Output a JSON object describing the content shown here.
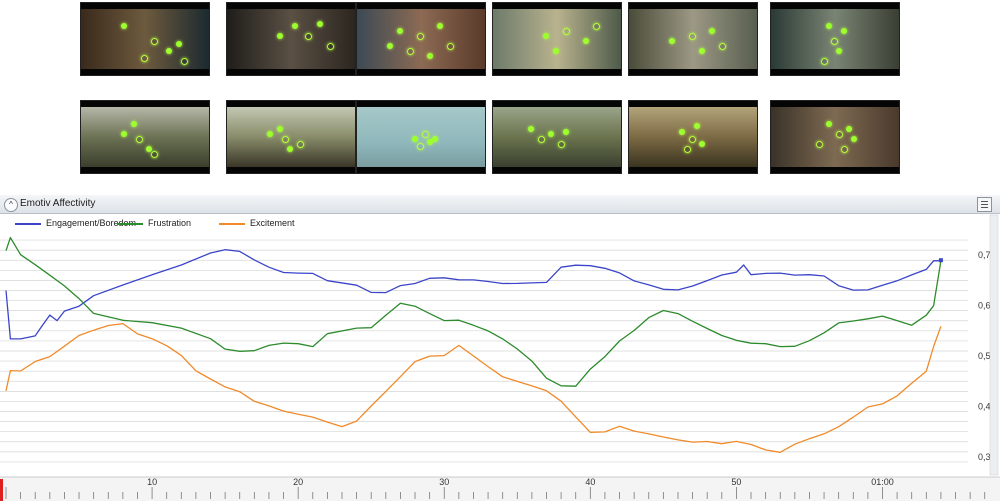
{
  "thumbnails": [
    {
      "name": "clip-1",
      "bg": "linear-gradient(90deg,#3a2a1c,#6d5a3e 50%,#1c2a30)",
      "row": 0,
      "col": 0
    },
    {
      "name": "clip-2",
      "bg": "linear-gradient(90deg,#1f1d1a,#5a5044 50%,#2c2620)",
      "row": 0,
      "col": 1
    },
    {
      "name": "clip-3",
      "bg": "linear-gradient(90deg,#3c4a55,#8c6a54 50%,#5a3a2a)",
      "row": 0,
      "col": 2
    },
    {
      "name": "clip-4",
      "bg": "linear-gradient(90deg,#6d7a6a,#b9b38e 50%,#4e5a4a)",
      "row": 0,
      "col": 3
    },
    {
      "name": "clip-5",
      "bg": "linear-gradient(90deg,#4a4c3a,#9c9884 50%,#585e50)",
      "row": 0,
      "col": 4
    },
    {
      "name": "clip-6",
      "bg": "linear-gradient(90deg,#2a3a34,#7a8474 50%,#3a3e34)",
      "row": 0,
      "col": 5
    },
    {
      "name": "clip-7",
      "bg": "linear-gradient(180deg,#b5b7a8,#6c7254 50%,#3a3e2c)",
      "row": 1,
      "col": 0
    },
    {
      "name": "clip-8",
      "bg": "linear-gradient(180deg,#c2c8b2,#888c6a 50%,#3a3628)",
      "row": 1,
      "col": 1
    },
    {
      "name": "clip-9",
      "bg": "linear-gradient(180deg,#a6c8c8,#8fb8bc 60%,#7a9ca0)",
      "row": 1,
      "col": 2
    },
    {
      "name": "clip-10",
      "bg": "linear-gradient(180deg,#9aa48a,#6a744e 50%,#3a4030)",
      "row": 1,
      "col": 3
    },
    {
      "name": "clip-11",
      "bg": "linear-gradient(180deg,#b3a47a,#7c6a44 50%,#3a3420)",
      "row": 1,
      "col": 4
    },
    {
      "name": "clip-12",
      "bg": "linear-gradient(90deg,#3a3228,#7e6a52 50%,#4a3a2c)",
      "row": 1,
      "col": 5
    }
  ],
  "panel": {
    "title": "Emotiv Affectivity",
    "collapse_glyph": "^"
  },
  "chart_data": {
    "type": "line",
    "xlabel": "",
    "ylabel": "",
    "xlim": [
      0,
      64
    ],
    "ylim": [
      0.28,
      0.74
    ],
    "x_ticks": [
      10,
      20,
      30,
      40,
      50,
      60
    ],
    "x_tick_labels": [
      "10",
      "20",
      "30",
      "40",
      "50",
      "01:00"
    ],
    "y_ticks": [
      0.3,
      0.4,
      0.5,
      0.6,
      0.7
    ],
    "y_tick_labels": [
      "0,3",
      "0,4",
      "0,5",
      "0,6",
      "0,7"
    ],
    "grid": true,
    "legend": "top-left",
    "series": [
      {
        "name": "Engagement/Boredom",
        "color": "#3b45c8",
        "x": [
          0,
          0.3,
          1,
          2,
          2.5,
          3,
          3.5,
          4,
          5,
          6,
          8,
          10,
          12,
          14,
          15,
          16,
          17,
          18,
          19,
          20,
          21,
          22,
          24,
          25,
          26,
          27,
          28,
          29,
          30,
          31,
          32,
          33,
          34,
          35,
          36,
          37,
          38,
          39,
          40,
          41,
          42,
          43,
          44,
          45,
          46,
          47,
          48,
          49,
          50,
          50.5,
          51,
          52,
          53,
          54,
          55,
          56,
          57,
          58,
          59,
          60,
          61,
          62,
          63,
          63.5,
          64
        ],
        "y": [
          0.63,
          0.535,
          0.535,
          0.54,
          0.56,
          0.58,
          0.57,
          0.59,
          0.6,
          0.62,
          0.64,
          0.66,
          0.68,
          0.705,
          0.712,
          0.708,
          0.69,
          0.675,
          0.665,
          0.665,
          0.665,
          0.65,
          0.64,
          0.625,
          0.625,
          0.64,
          0.645,
          0.655,
          0.655,
          0.65,
          0.65,
          0.648,
          0.645,
          0.645,
          0.645,
          0.645,
          0.675,
          0.68,
          0.68,
          0.675,
          0.665,
          0.648,
          0.64,
          0.632,
          0.632,
          0.64,
          0.65,
          0.66,
          0.665,
          0.68,
          0.662,
          0.665,
          0.665,
          0.66,
          0.66,
          0.658,
          0.64,
          0.632,
          0.632,
          0.64,
          0.648,
          0.66,
          0.672,
          0.69,
          0.69
        ]
      },
      {
        "name": "Frustration",
        "color": "#2d8b2d",
        "x": [
          0,
          0.3,
          1,
          2,
          3,
          4,
          5,
          6,
          8,
          10,
          12,
          14,
          15,
          16,
          17,
          18,
          19,
          20,
          21,
          22,
          24,
          25,
          26,
          27,
          28,
          29,
          30,
          31,
          32,
          33,
          34,
          35,
          36,
          37,
          38,
          39,
          40,
          41,
          42,
          43,
          44,
          45,
          46,
          47,
          48,
          49,
          50,
          51,
          52,
          53,
          54,
          55,
          56,
          57,
          58,
          59,
          60,
          61,
          62,
          63,
          63.5,
          64
        ],
        "y": [
          0.71,
          0.735,
          0.7,
          0.68,
          0.66,
          0.64,
          0.615,
          0.585,
          0.57,
          0.565,
          0.555,
          0.535,
          0.515,
          0.51,
          0.51,
          0.52,
          0.525,
          0.525,
          0.52,
          0.545,
          0.555,
          0.555,
          0.58,
          0.605,
          0.6,
          0.585,
          0.57,
          0.57,
          0.56,
          0.55,
          0.535,
          0.515,
          0.49,
          0.455,
          0.44,
          0.44,
          0.475,
          0.5,
          0.53,
          0.55,
          0.575,
          0.59,
          0.585,
          0.57,
          0.555,
          0.54,
          0.53,
          0.525,
          0.525,
          0.52,
          0.52,
          0.53,
          0.545,
          0.565,
          0.57,
          0.575,
          0.58,
          0.57,
          0.56,
          0.58,
          0.6,
          0.69
        ]
      },
      {
        "name": "Excitement",
        "color": "#f08a2a",
        "x": [
          0,
          0.3,
          1,
          2,
          3,
          4,
          5,
          6,
          7,
          8,
          9,
          10,
          11,
          12,
          13,
          14,
          15,
          16,
          17,
          18,
          19,
          20,
          21,
          22,
          23,
          24,
          25,
          26,
          27,
          28,
          29,
          30,
          31,
          32,
          33,
          34,
          35,
          36,
          37,
          38,
          39,
          40,
          41,
          42,
          43,
          44,
          45,
          46,
          47,
          48,
          49,
          50,
          51,
          52,
          53,
          54,
          55,
          56,
          57,
          58,
          59,
          60,
          61,
          62,
          63,
          63.5,
          64
        ],
        "y": [
          0.43,
          0.47,
          0.47,
          0.49,
          0.5,
          0.52,
          0.54,
          0.55,
          0.56,
          0.565,
          0.545,
          0.535,
          0.52,
          0.5,
          0.47,
          0.455,
          0.44,
          0.43,
          0.41,
          0.4,
          0.39,
          0.385,
          0.38,
          0.37,
          0.36,
          0.37,
          0.4,
          0.43,
          0.46,
          0.49,
          0.5,
          0.5,
          0.52,
          0.5,
          0.48,
          0.46,
          0.45,
          0.44,
          0.43,
          0.41,
          0.38,
          0.35,
          0.35,
          0.36,
          0.35,
          0.345,
          0.34,
          0.335,
          0.33,
          0.33,
          0.325,
          0.33,
          0.325,
          0.315,
          0.31,
          0.325,
          0.335,
          0.345,
          0.36,
          0.38,
          0.4,
          0.405,
          0.42,
          0.445,
          0.47,
          0.52,
          0.56
        ]
      }
    ]
  },
  "colors": {
    "gaze": "#9cff2e",
    "playhead": "#e02020",
    "grid": "#d6d6d6"
  }
}
